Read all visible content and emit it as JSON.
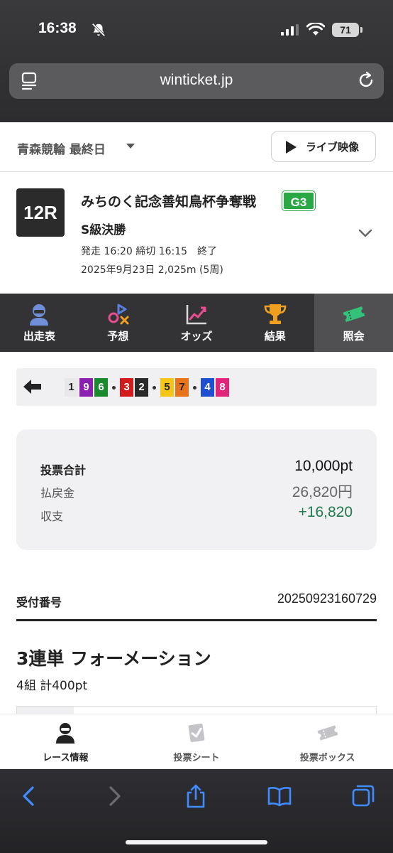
{
  "status_bar": {
    "time": "16:38",
    "battery": "71"
  },
  "browser": {
    "url": "winticket.jp"
  },
  "venue": {
    "name": "青森競輪 最終日",
    "live_button": "ライブ映像"
  },
  "race": {
    "number": "12R",
    "title": "みちのく記念善知鳥杯争奪戦",
    "grade": "G3",
    "subtitle": "S級決勝",
    "start_close": "発走 16:20 締切 16:15　終了",
    "date_distance": "2025年9月23日 2,025m (5周)"
  },
  "tabs": [
    {
      "label": "出走表",
      "icon": "racer-icon"
    },
    {
      "label": "予想",
      "icon": "prediction-icon"
    },
    {
      "label": "オッズ",
      "icon": "odds-chart-icon"
    },
    {
      "label": "結果",
      "icon": "trophy-icon"
    },
    {
      "label": "照会",
      "icon": "ticket-icon",
      "active": true
    }
  ],
  "line_up": {
    "groups": [
      [
        {
          "n": "1",
          "bg": "#e8e8ea",
          "fg": "#222"
        },
        {
          "n": "9",
          "bg": "#8a1fb0",
          "fg": "#fff"
        },
        {
          "n": "6",
          "bg": "#1a8a2f",
          "fg": "#fff"
        }
      ],
      [
        {
          "n": "3",
          "bg": "#d21c1c",
          "fg": "#fff"
        },
        {
          "n": "2",
          "bg": "#2a2a2a",
          "fg": "#fff"
        }
      ],
      [
        {
          "n": "5",
          "bg": "#f5c518",
          "fg": "#222"
        },
        {
          "n": "7",
          "bg": "#e8731a",
          "fg": "#222"
        }
      ],
      [
        {
          "n": "4",
          "bg": "#1f4fd1",
          "fg": "#fff"
        },
        {
          "n": "8",
          "bg": "#e2247a",
          "fg": "#fff"
        }
      ]
    ]
  },
  "summary": {
    "total_label": "投票合計",
    "total_value": "10,000pt",
    "payout_label": "払戻金",
    "payout_value": "26,820円",
    "balance_label": "収支",
    "balance_value": "+16,820",
    "balance_color": "#1f7a4d"
  },
  "receipt": {
    "label": "受付番号",
    "number": "20250923160729"
  },
  "bet": {
    "type": "3連単 フォーメーション",
    "count": "4組 計400pt"
  },
  "app_nav": [
    {
      "label": "レース情報",
      "icon": "racer-icon",
      "active": true
    },
    {
      "label": "投票シート",
      "icon": "bet-sheet-icon"
    },
    {
      "label": "投票ボックス",
      "icon": "ticket-box-icon"
    }
  ]
}
